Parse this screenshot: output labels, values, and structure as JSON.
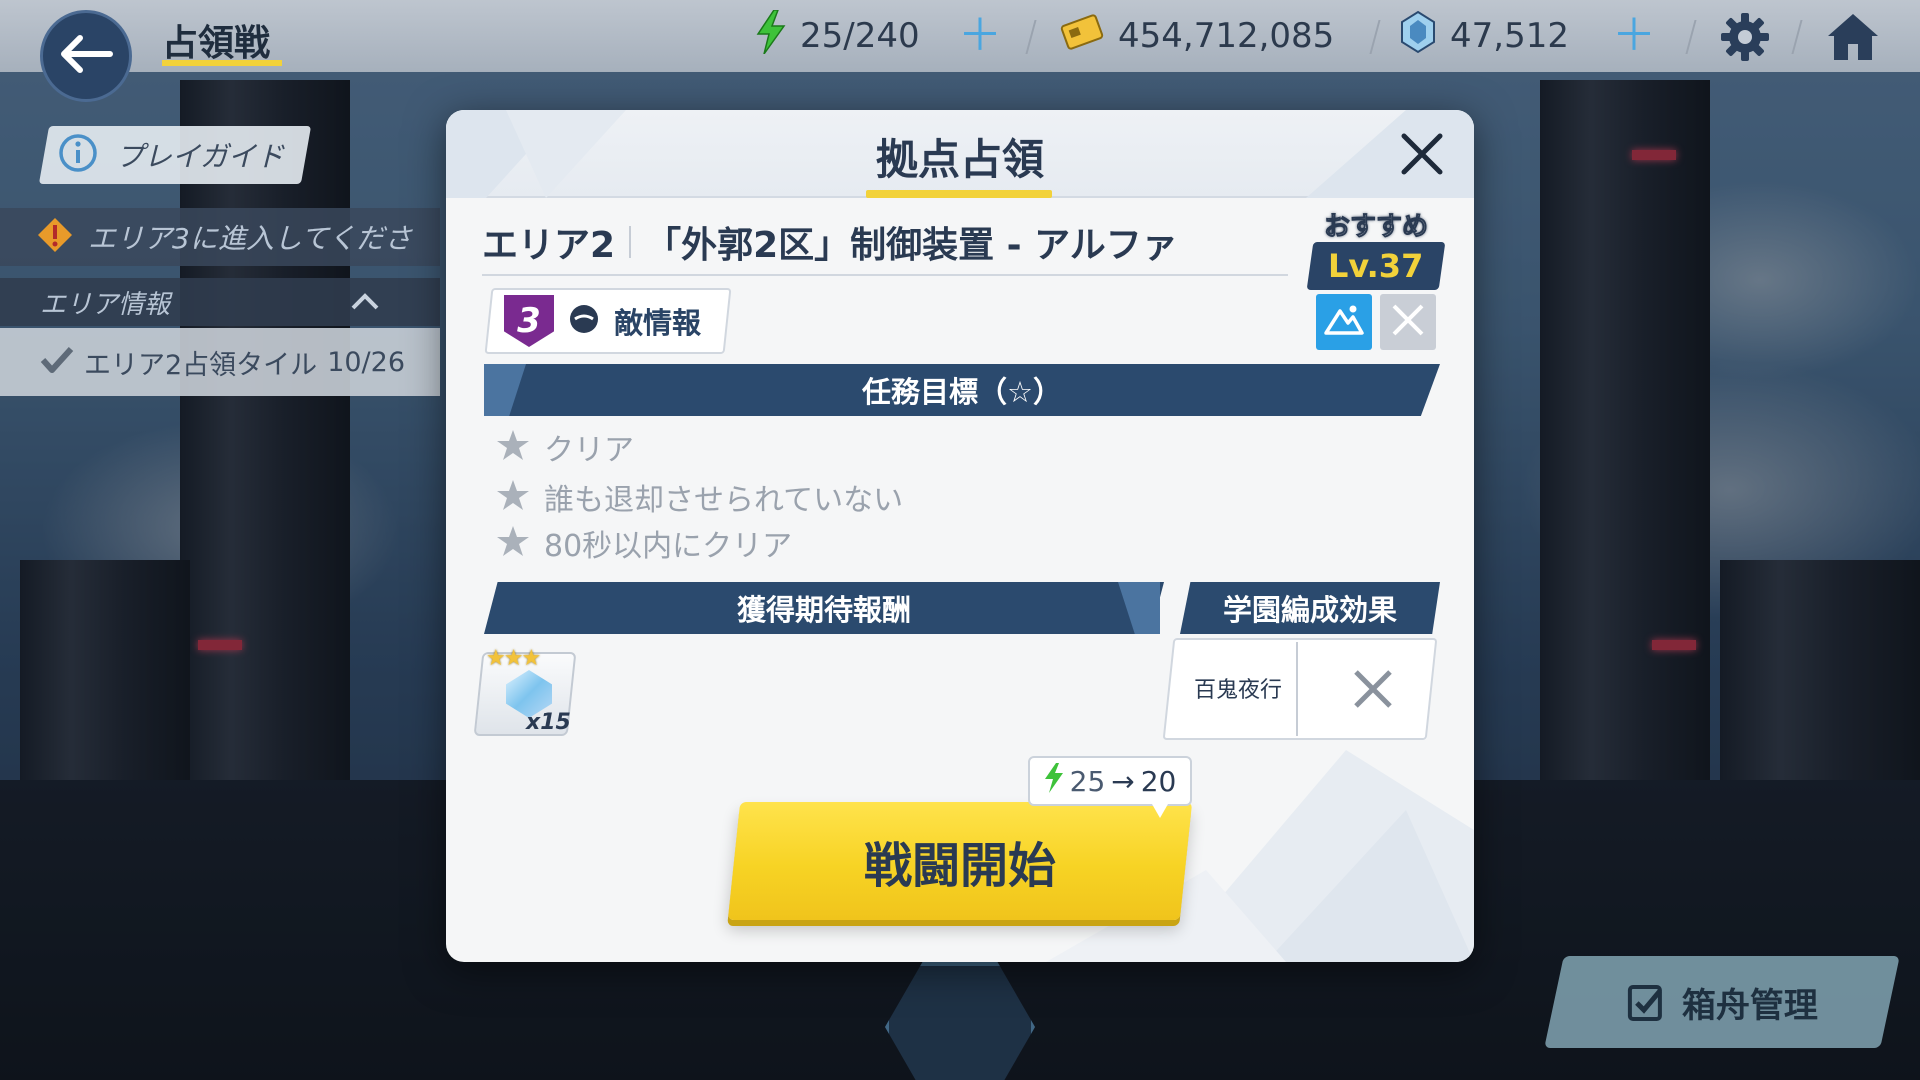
{
  "topbar": {
    "title": "占領戦",
    "stamina": "25/240",
    "credits": "454,712,085",
    "gems": "47,512"
  },
  "left_panel": {
    "guide_label": "プレイガイド",
    "notice_text": "エリア3に進入してくださ",
    "area_info_label": "エリア情報",
    "area_progress_label": "エリア2占領タイル",
    "area_progress_value": "10/26"
  },
  "ark_button_label": "箱舟管理",
  "modal": {
    "title": "拠点占領",
    "area_name": "エリア2",
    "stage_name": "「外郭2区」制御装置 - アルファ",
    "recommended_label": "おすすめ",
    "recommended_level": "Lv.37",
    "difficulty": "3",
    "enemy_info_label": "敵情報",
    "objectives_header": "任務目標（☆）",
    "objectives": [
      "クリア",
      "誰も退却させられていない",
      "80秒以内にクリア"
    ],
    "rewards_header": "獲得期待報酬",
    "reward_quantity": "x15",
    "formation_header": "学園編成効果",
    "formation_name": "百鬼夜行",
    "cost_from": "25",
    "cost_to": "20",
    "start_label": "戦闘開始"
  },
  "colors": {
    "accent_yellow": "#f2d23a",
    "band_navy": "#2b4a6e",
    "terrain_blue": "#2aa0e6",
    "difficulty_purple": "#7a2a90",
    "stamina_green": "#3ec23a"
  },
  "icons": [
    "back-arrow-icon",
    "lightning-icon",
    "credit-card-icon",
    "gem-icon",
    "plus-icon",
    "gear-icon",
    "home-icon",
    "info-icon",
    "warning-icon",
    "chevron-up-icon",
    "check-icon",
    "clipboard-check-icon",
    "close-icon",
    "enemy-face-icon",
    "terrain-icon",
    "star-icon"
  ]
}
